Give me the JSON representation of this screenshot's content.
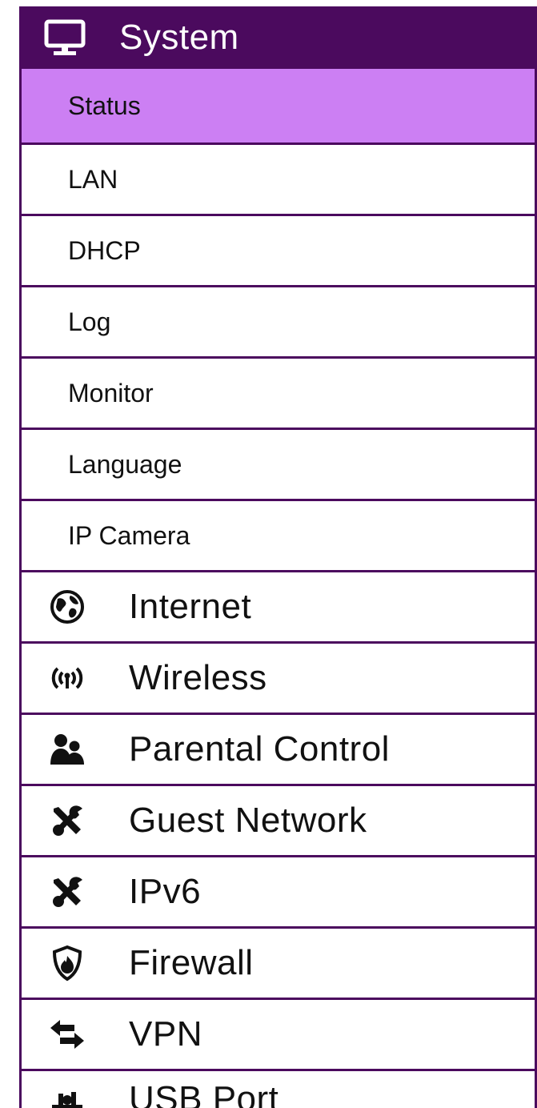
{
  "menu": {
    "system": {
      "label": "System",
      "icon": "monitor-icon",
      "items": [
        {
          "label": "Status",
          "active": true
        },
        {
          "label": "LAN"
        },
        {
          "label": "DHCP"
        },
        {
          "label": "Log"
        },
        {
          "label": "Monitor"
        },
        {
          "label": "Language"
        },
        {
          "label": "IP Camera"
        }
      ]
    },
    "sections": [
      {
        "label": "Internet",
        "icon": "globe-icon"
      },
      {
        "label": "Wireless",
        "icon": "wireless-icon"
      },
      {
        "label": "Parental Control",
        "icon": "users-icon"
      },
      {
        "label": "Guest Network",
        "icon": "tools-icon"
      },
      {
        "label": "IPv6",
        "icon": "tools-icon"
      },
      {
        "label": "Firewall",
        "icon": "shield-fire-icon"
      },
      {
        "label": "VPN",
        "icon": "arrows-exchange-icon"
      },
      {
        "label": "USB Port",
        "icon": "usb-icon"
      }
    ]
  },
  "colors": {
    "header_bg": "#4b0a5e",
    "active_bg": "#cc7ff3",
    "border": "#4b0a5e"
  }
}
